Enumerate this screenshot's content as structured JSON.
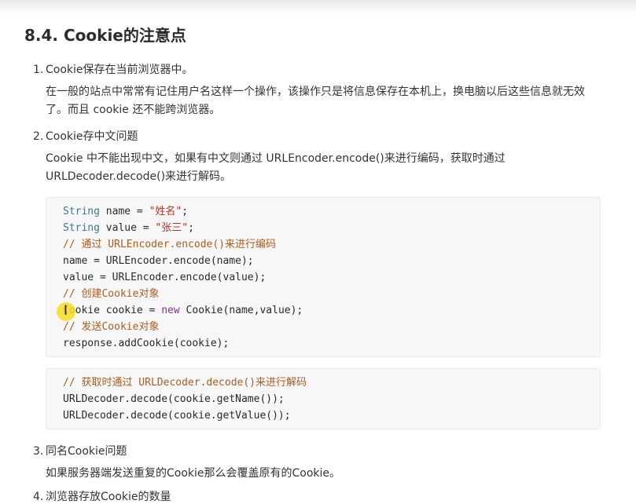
{
  "section": {
    "heading": "8.4. Cookie的注意点"
  },
  "items": [
    {
      "num": "1.",
      "title": "Cookie保存在当前浏览器中。",
      "para": "在一般的站点中常常有记住用户名这样一个操作，该操作只是将信息保存在本机上，换电脑以后这些信息就无效了。而且 cookie 还不能跨浏览器。"
    },
    {
      "num": "2.",
      "title": "Cookie存中文问题",
      "para": "Cookie 中不能出现中文，如果有中文则通过 URLEncoder.encode()来进行编码，获取时通过 URLDecoder.decode()来进行解码。"
    },
    {
      "num": "3.",
      "title": "同名Cookie问题",
      "para": "如果服务器端发送重复的Cookie那么会覆盖原有的Cookie。"
    },
    {
      "num": "4.",
      "title": "浏览器存放Cookie的数量"
    }
  ],
  "code1": {
    "l1": {
      "kw": "String",
      "rest": " name = ",
      "str": "\"姓名\"",
      "end": ";"
    },
    "l2": {
      "kw": "String",
      "rest": " value = ",
      "str": "\"张三\"",
      "end": ";"
    },
    "l3": "// 通过 URLEncoder.encode()来进行编码",
    "l4": "name = URLEncoder.encode(name);",
    "l5": "value = URLEncoder.encode(value);",
    "l6": "// 创建Cookie对象",
    "l7": {
      "pre": "Cookie cookie = ",
      "kw": "new",
      "post": " Cookie(name,value);"
    },
    "l8": "// 发送Cookie对象",
    "l9": "response.addCookie(cookie);"
  },
  "code2": {
    "l1": "// 获取时通过 URLDecoder.decode()来进行解码",
    "l2": "URLDecoder.decode(cookie.getName());",
    "l3": "URLDecoder.decode(cookie.getValue());"
  },
  "colors": {
    "keyword": "#3d7a8a",
    "string": "#b8332b",
    "comment": "#a95d20",
    "new_keyword": "#8a2f9c",
    "code_bg": "#f7f7f8",
    "cursor_highlight": "#f6de28"
  },
  "icons": {
    "cursor": "text-cursor-icon"
  }
}
